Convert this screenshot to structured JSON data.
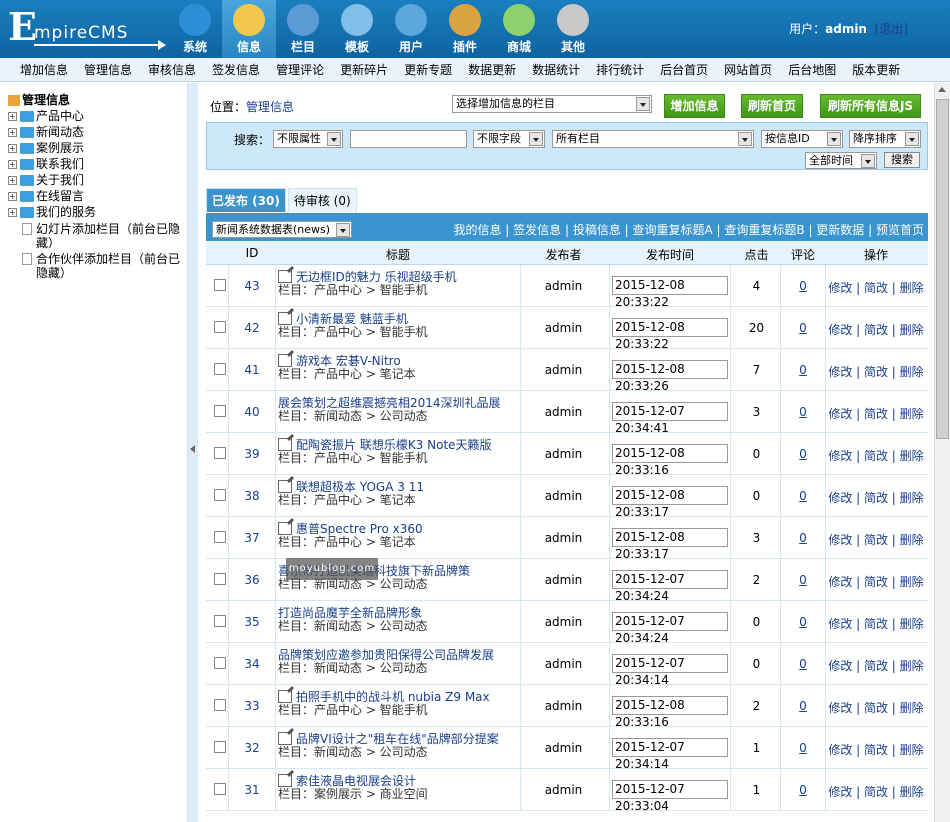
{
  "header": {
    "logo": {
      "first_letter": "E",
      "rest": "mpireCMS"
    },
    "nav": [
      {
        "label": "系统",
        "icon": "globe-icon",
        "color": "#2b8fd6"
      },
      {
        "label": "信息",
        "icon": "notepad-pencil-icon",
        "color": "#f2c94c"
      },
      {
        "label": "栏目",
        "icon": "folder-icon",
        "color": "#5b9bd5"
      },
      {
        "label": "模板",
        "icon": "window-template-icon",
        "color": "#7fbfe8"
      },
      {
        "label": "用户",
        "icon": "user-icon",
        "color": "#5aa6dd"
      },
      {
        "label": "插件",
        "icon": "tools-icon",
        "color": "#d9a441"
      },
      {
        "label": "商城",
        "icon": "shop-card-icon",
        "color": "#8fd16a"
      },
      {
        "label": "其他",
        "icon": "gear-icon",
        "color": "#c9c9c9"
      }
    ],
    "user_label": "用户：",
    "username": "admin",
    "logout": "[退出]"
  },
  "subnav": [
    "增加信息",
    "管理信息",
    "审核信息",
    "签发信息",
    "管理评论",
    "更新碎片",
    "更新专题",
    "数据更新",
    "数据统计",
    "排行统计",
    "后台首页",
    "网站首页",
    "后台地图",
    "版本更新"
  ],
  "sidebar": {
    "title": "管理信息",
    "nodes": [
      "产品中心",
      "新闻动态",
      "案例展示",
      "联系我们",
      "关于我们",
      "在线留言",
      "我们的服务"
    ],
    "leaves": [
      "幻灯片添加栏目（前台已隐藏）",
      "合作伙伴添加栏目（前台已隐藏）"
    ]
  },
  "main": {
    "position_label": "位置：",
    "position_link": "管理信息",
    "select_column": "选择增加信息的栏目",
    "buttons": {
      "add": "增加信息",
      "refresh_home": "刷新首页",
      "refresh_js": "刷新所有信息JS"
    },
    "search": {
      "label": "搜索：",
      "attr": "不限属性",
      "keyword": "",
      "field": "不限字段",
      "column": "所有栏目",
      "sort_by": "按信息ID",
      "order": "降序排序",
      "time": "全部时间",
      "submit": "搜索"
    },
    "tabs": [
      {
        "label": "已发布 (30)"
      },
      {
        "label": "待审核 (0)"
      }
    ],
    "table_select": "新闻系统数据表(news)",
    "toolbar_links": [
      "我的信息",
      "签发信息",
      "投稿信息",
      "查询重复标题A",
      "查询重复标题B",
      "更新数据",
      "预览首页"
    ],
    "columns": {
      "id": "ID",
      "title": "标题",
      "publisher": "发布者",
      "time": "发布时间",
      "clicks": "点击",
      "comments": "评论",
      "ops": "操作"
    },
    "ops_text": "修改 | 简改 | 删除",
    "rows": [
      {
        "id": "43",
        "title": "无边框ID的魅力 乐视超级手机",
        "cat": "栏目：产品中心 > 智能手机",
        "icon": true,
        "publisher": "admin",
        "time": "2015-12-08 20:33:22",
        "clicks": "4",
        "comments": "0"
      },
      {
        "id": "42",
        "title": "小清新最爱 魅蓝手机",
        "cat": "栏目：产品中心 > 智能手机",
        "icon": true,
        "publisher": "admin",
        "time": "2015-12-08 20:33:22",
        "clicks": "20",
        "comments": "0"
      },
      {
        "id": "41",
        "title": "游戏本 宏碁V-Nitro",
        "cat": "栏目：产品中心 > 笔记本",
        "icon": true,
        "publisher": "admin",
        "time": "2015-12-08 20:33:26",
        "clicks": "7",
        "comments": "0"
      },
      {
        "id": "40",
        "title": "展会策划之超维震撼亮相2014深圳礼品展",
        "cat": "栏目：新闻动态 > 公司动态",
        "icon": false,
        "publisher": "admin",
        "time": "2015-12-07 20:34:41",
        "clicks": "3",
        "comments": "0"
      },
      {
        "id": "39",
        "title": "配陶瓷振片 联想乐檬K3 Note天籁版",
        "cat": "栏目：产品中心 > 智能手机",
        "icon": true,
        "publisher": "admin",
        "time": "2015-12-08 20:33:16",
        "clicks": "0",
        "comments": "0"
      },
      {
        "id": "38",
        "title": "联想超极本 YOGA 3 11",
        "cat": "栏目：产品中心 > 笔记本",
        "icon": true,
        "publisher": "admin",
        "time": "2015-12-08 20:33:17",
        "clicks": "0",
        "comments": "0"
      },
      {
        "id": "37",
        "title": "惠普Spectre Pro x360",
        "cat": "栏目：产品中心 > 笔记本",
        "icon": true,
        "publisher": "admin",
        "time": "2015-12-08 20:33:17",
        "clicks": "3",
        "comments": "0"
      },
      {
        "id": "36",
        "title": "喜乐蒂打造凯美瑞科技旗下新品牌策",
        "cat": "栏目：新闻动态 > 公司动态",
        "icon": false,
        "publisher": "admin",
        "time": "2015-12-07 20:34:24",
        "clicks": "2",
        "comments": "0"
      },
      {
        "id": "35",
        "title": "打造尚品魔芋全新品牌形象",
        "cat": "栏目：新闻动态 > 公司动态",
        "icon": false,
        "publisher": "admin",
        "time": "2015-12-07 20:34:24",
        "clicks": "0",
        "comments": "0"
      },
      {
        "id": "34",
        "title": "品牌策划应邀参加贵阳保得公司品牌发展",
        "cat": "栏目：新闻动态 > 公司动态",
        "icon": false,
        "publisher": "admin",
        "time": "2015-12-07 20:34:14",
        "clicks": "0",
        "comments": "0"
      },
      {
        "id": "33",
        "title": "拍照手机中的战斗机 nubia Z9 Max",
        "cat": "栏目：产品中心 > 智能手机",
        "icon": true,
        "publisher": "admin",
        "time": "2015-12-08 20:33:16",
        "clicks": "2",
        "comments": "0"
      },
      {
        "id": "32",
        "title": "品牌VI设计之\"租车在线\"品牌部分提案",
        "cat": "栏目：新闻动态 > 公司动态",
        "icon": true,
        "publisher": "admin",
        "time": "2015-12-07 20:34:14",
        "clicks": "1",
        "comments": "0"
      },
      {
        "id": "31",
        "title": "索佳液晶电视展会设计",
        "cat": "栏目：案例展示 > 商业空间",
        "icon": true,
        "publisher": "admin",
        "time": "2015-12-07 20:33:04",
        "clicks": "1",
        "comments": "0"
      }
    ]
  },
  "watermark": "moyublog.com",
  "colors": {
    "header": "#1a7fbf",
    "accent": "#3a94d0",
    "green_button": "#4ca51f",
    "link": "#1a3f8a"
  }
}
